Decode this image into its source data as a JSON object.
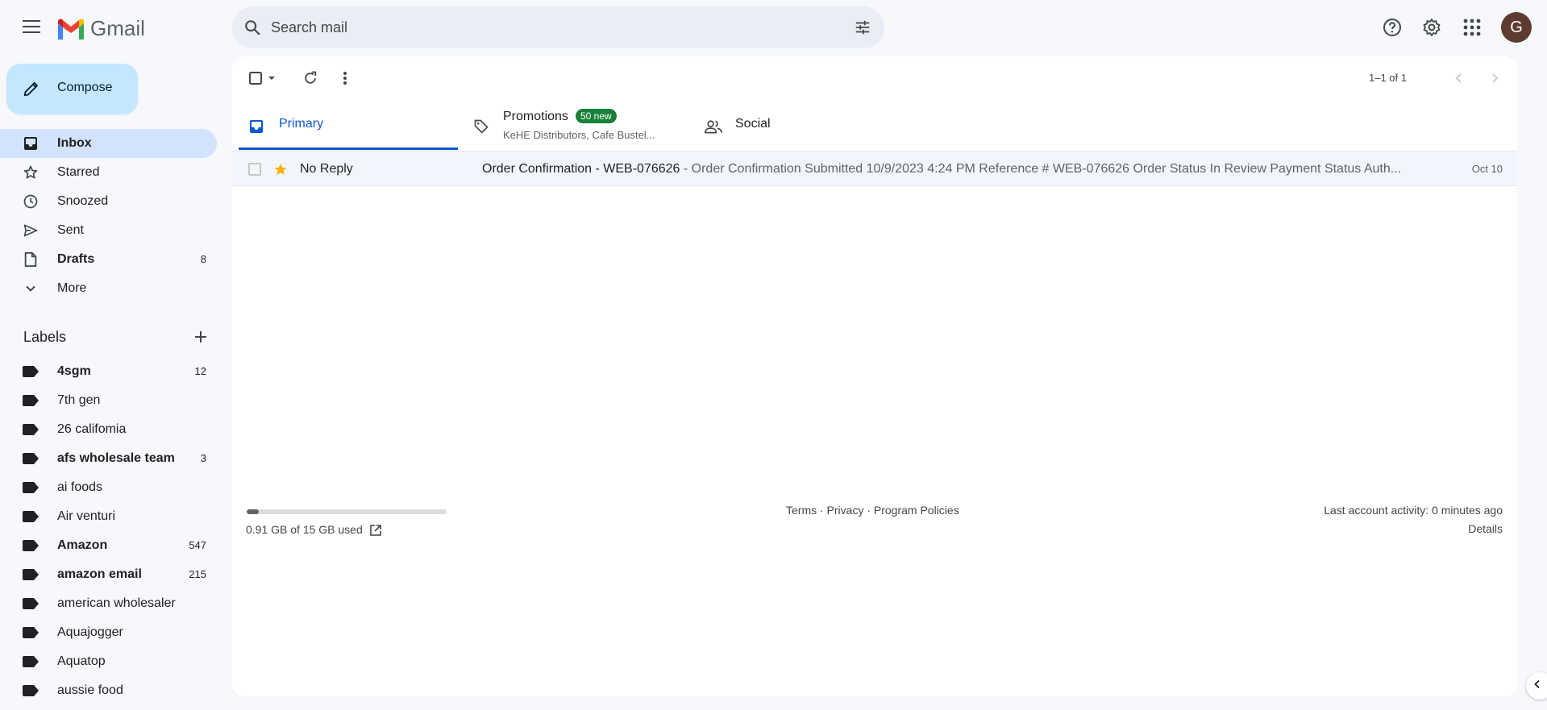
{
  "header": {
    "app_name": "Gmail",
    "search_placeholder": "Search mail",
    "avatar_initial": "G",
    "icons": [
      "menu-icon",
      "gmail-logo",
      "search-icon",
      "tune-icon",
      "help-icon",
      "gear-icon",
      "apps-grid-icon"
    ]
  },
  "compose": {
    "label": "Compose"
  },
  "nav": {
    "items": [
      {
        "label": "Inbox",
        "count": "",
        "icon": "inbox-icon"
      },
      {
        "label": "Starred",
        "count": "",
        "icon": "star-outline-icon"
      },
      {
        "label": "Snoozed",
        "count": "",
        "icon": "clock-icon"
      },
      {
        "label": "Sent",
        "count": "",
        "icon": "send-icon"
      },
      {
        "label": "Drafts",
        "count": "8",
        "icon": "draft-icon"
      },
      {
        "label": "More",
        "count": "",
        "icon": "chevron-down-icon"
      }
    ]
  },
  "labels": {
    "heading": "Labels",
    "items": [
      {
        "name": "4sgm",
        "count": "12"
      },
      {
        "name": "7th gen",
        "count": ""
      },
      {
        "name": "26 califomia",
        "count": ""
      },
      {
        "name": "afs wholesale team",
        "count": "3"
      },
      {
        "name": "ai foods",
        "count": ""
      },
      {
        "name": "Air venturi",
        "count": ""
      },
      {
        "name": "Amazon",
        "count": "547"
      },
      {
        "name": "amazon email",
        "count": "215"
      },
      {
        "name": "american wholesaler",
        "count": ""
      },
      {
        "name": "Aquajogger",
        "count": ""
      },
      {
        "name": "Aquatop",
        "count": ""
      },
      {
        "name": "aussie food",
        "count": ""
      }
    ]
  },
  "toolbar": {
    "pager": "1–1 of 1"
  },
  "tabs": {
    "primary": {
      "label": "Primary"
    },
    "promotions": {
      "label": "Promotions",
      "badge": "50 new",
      "sub": "KeHE Distributors, Cafe Bustel..."
    },
    "social": {
      "label": "Social"
    }
  },
  "emails": [
    {
      "sender": "No Reply",
      "subject": "Order Confirmation - WEB-076626",
      "snippet": " - Order Confirmation Submitted 10/9/2023 4:24 PM Reference # WEB-076626 Order Status In Review Payment Status Auth...",
      "date": "Oct 10",
      "starred": true
    }
  ],
  "footer": {
    "storage": "0.91 GB of 15 GB used",
    "storage_fraction": 0.06,
    "links": "Terms · Privacy · Program Policies",
    "activity": "Last account activity: 0 minutes ago",
    "details": "Details"
  },
  "colors": {
    "accent": "#0b57d0",
    "compose_bg": "#c2e7ff",
    "active_nav": "#d3e3fd",
    "badge": "#188038",
    "star": "#f4b400"
  }
}
